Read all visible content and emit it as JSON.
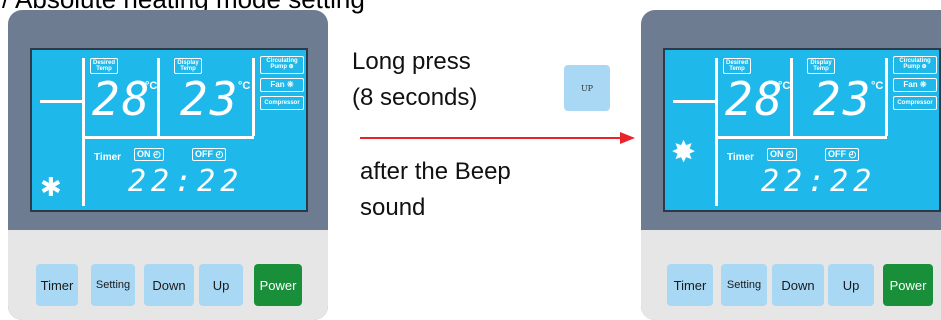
{
  "heading": "/ Absolute heating mode setting",
  "instructions": {
    "line1": "Long press",
    "line2": "(8 seconds)",
    "line3": "after the Beep",
    "line4": "sound",
    "up_button_label": "UP"
  },
  "display": {
    "desired_temp_tag": "Desired Temp",
    "display_temp_tag": "Display Temp",
    "desired_value": "28",
    "display_value": "23",
    "unit": "°C",
    "circulating_pump_tag": "Circulating Pump ⊕",
    "fan_tag": "Fan ❊",
    "compressor_tag": "Compressor",
    "timer_label": "Timer",
    "on_chip": "ON ◴",
    "off_chip": "OFF ◴",
    "clock": "22:22"
  },
  "left_controller": {
    "mode_icon": "✱",
    "mode_icon_name": "snowflake-icon"
  },
  "right_controller": {
    "mode_icon": "✸",
    "mode_icon_name": "sun-icon"
  },
  "keypad": {
    "timer": "Timer",
    "setting": "Setting",
    "down": "Down",
    "up": "Up",
    "power": "Power"
  },
  "colors": {
    "lcd": "#1fb8ea",
    "frame": "#6d7c90",
    "key": "#a9d8f4",
    "power_key": "#1a8f3a",
    "arrow": "#e8232a"
  }
}
